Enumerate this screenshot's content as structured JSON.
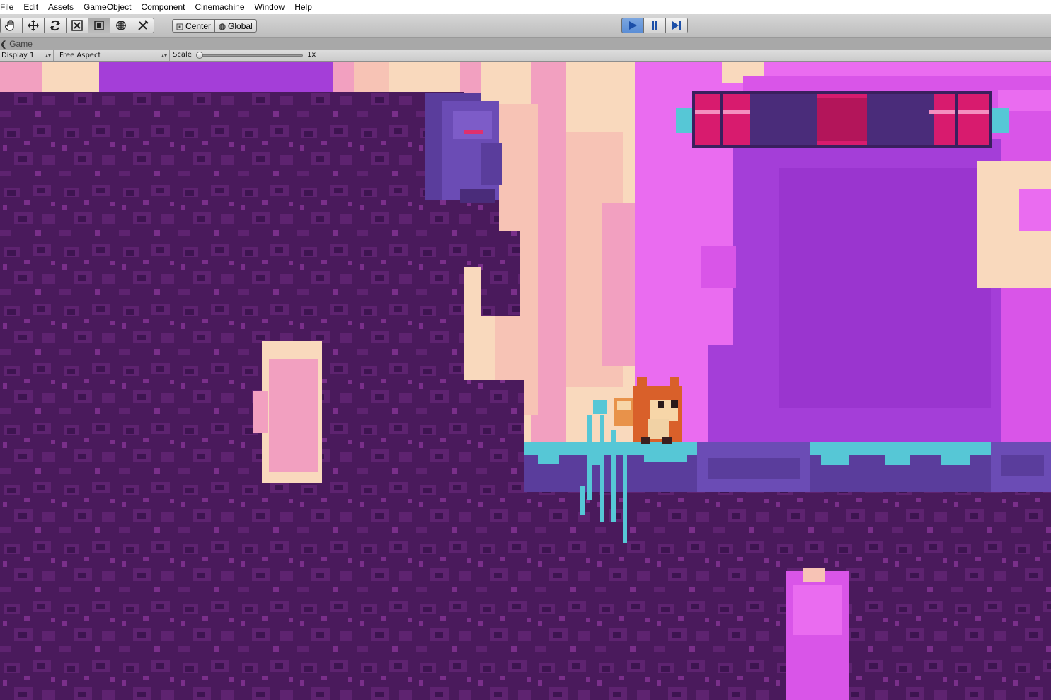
{
  "menu": {
    "items": [
      "File",
      "Edit",
      "Assets",
      "GameObject",
      "Component",
      "Cinemachine",
      "Window",
      "Help"
    ]
  },
  "toolbar": {
    "tools": [
      {
        "name": "hand-tool-icon",
        "active": false
      },
      {
        "name": "move-tool-icon",
        "active": false
      },
      {
        "name": "rotate-tool-icon",
        "active": false
      },
      {
        "name": "scale-tool-icon",
        "active": false
      },
      {
        "name": "rect-tool-icon",
        "active": true
      },
      {
        "name": "transform-tool-icon",
        "active": false
      },
      {
        "name": "custom-tool-icon",
        "active": false
      }
    ],
    "pivot_label": "Center",
    "rotation_label": "Global",
    "playback": {
      "play_active": true
    }
  },
  "tab": {
    "title": "Game"
  },
  "game_toolbar": {
    "display": "Display 1",
    "aspect": "Free Aspect",
    "scale_label": "Scale",
    "scale_value": "1x",
    "scale_fraction": 0.0
  },
  "colors": {
    "rock_dark": "#4a1a5c",
    "rock_mid": "#5e2370",
    "rock_spot": "#7a2f8a",
    "cream": "#f9d9bd",
    "pink": "#f2a0c0",
    "magenta": "#d955e8",
    "violet": "#a43ed8",
    "teal": "#56c7d6",
    "stone": "#5a3d9c",
    "fox": "#d9602a",
    "platform_pink": "#d81b6e"
  }
}
